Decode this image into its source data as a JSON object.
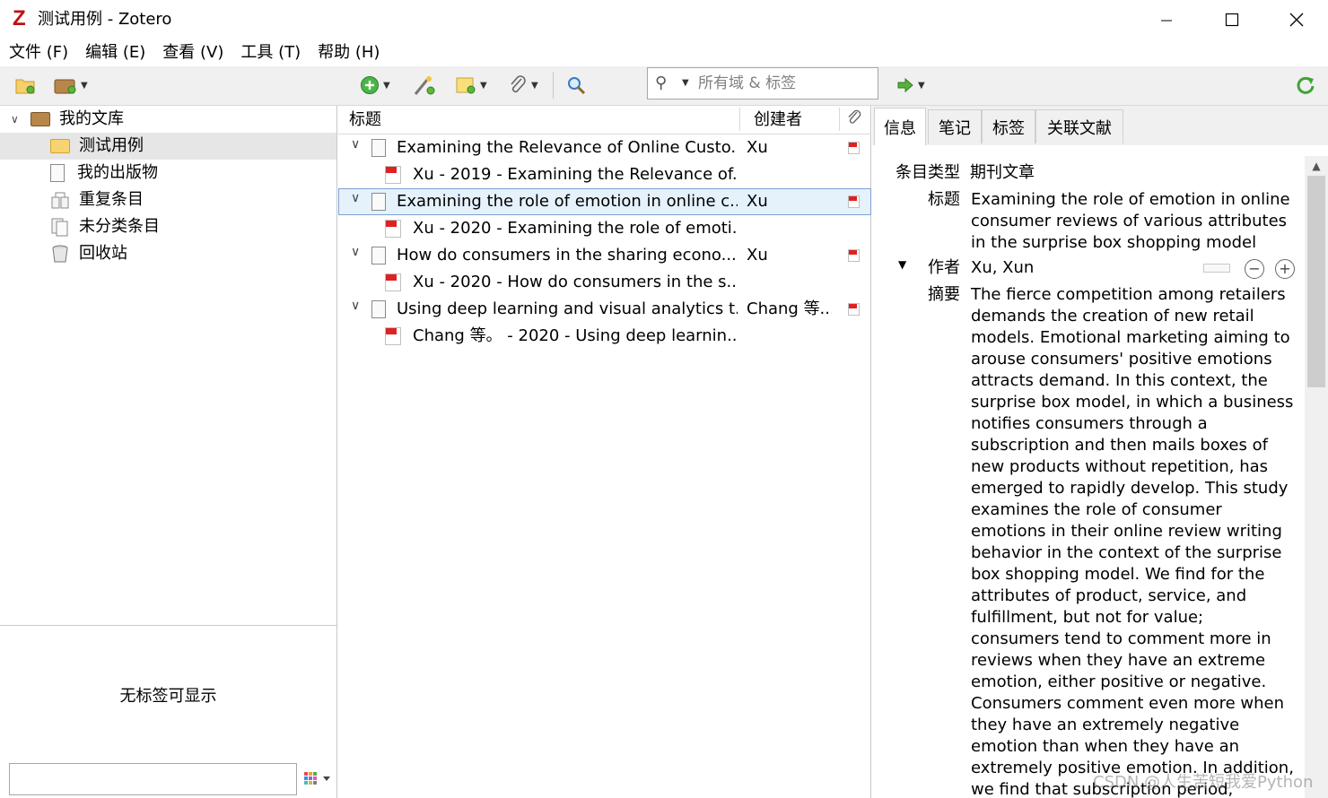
{
  "window": {
    "title": "测试用例 - Zotero",
    "logo_letter": "Z"
  },
  "menu": [
    "文件 (F)",
    "编辑 (E)",
    "查看 (V)",
    "工具 (T)",
    "帮助 (H)"
  ],
  "toolbar": {
    "search_placeholder": "所有域 & 标签",
    "icons": [
      "new-collection-icon",
      "new-library-icon",
      "new-item-icon",
      "add-by-identifier-icon",
      "new-note-icon",
      "attachment-icon",
      "advanced-search-icon",
      "sync-icon"
    ]
  },
  "collections": {
    "library": "我的文库",
    "items": [
      {
        "label": "测试用例",
        "icon": "folder-icon",
        "selected": true
      },
      {
        "label": "我的出版物",
        "icon": "publications-icon",
        "selected": false
      },
      {
        "label": "重复条目",
        "icon": "duplicates-icon",
        "selected": false
      },
      {
        "label": "未分类条目",
        "icon": "unfiled-icon",
        "selected": false
      },
      {
        "label": "回收站",
        "icon": "trash-icon",
        "selected": false
      }
    ]
  },
  "tags": {
    "empty_message": "无标签可显示",
    "filter_value": ""
  },
  "items_table": {
    "headers": {
      "title": "标题",
      "creator": "创建者"
    },
    "rows": [
      {
        "type": "parent",
        "title": "Examining the Relevance of Online Custo...",
        "creator": "Xu",
        "selected": false
      },
      {
        "type": "child",
        "title": "Xu - 2019 - Examining the Relevance of...",
        "creator": "",
        "selected": false
      },
      {
        "type": "parent",
        "title": "Examining the role of emotion in online c...",
        "creator": "Xu",
        "selected": true
      },
      {
        "type": "child",
        "title": "Xu - 2020 - Examining the role of emoti...",
        "creator": "",
        "selected": false
      },
      {
        "type": "parent",
        "title": "How do consumers in the sharing econo...",
        "creator": "Xu",
        "selected": false
      },
      {
        "type": "child",
        "title": "Xu - 2020 - How do consumers in the s...",
        "creator": "",
        "selected": false
      },
      {
        "type": "parent",
        "title": "Using deep learning and visual analytics t...",
        "creator": "Chang 等...",
        "selected": false
      },
      {
        "type": "child",
        "title": "Chang 等。 - 2020 - Using deep learnin...",
        "creator": "",
        "selected": false
      }
    ]
  },
  "detail": {
    "tabs": [
      "信息",
      "笔记",
      "标签",
      "关联文献"
    ],
    "active_tab": 0,
    "item_type_label": "条目类型",
    "item_type_value": "期刊文章",
    "title_label": "标题",
    "title_value": "Examining the role of emotion in online consumer reviews of various attributes in the surprise box shopping model",
    "author_label": "作者",
    "author_value": "Xu, Xun",
    "abstract_label": "摘要",
    "abstract_value": "The fierce competition among retailers demands the creation of new retail models. Emotional marketing aiming to arouse consumers' positive emotions attracts demand. In this context, the surprise box model, in which a business notifies consumers through a subscription and then mails boxes of new products without repetition, has emerged to rapidly develop. This study examines the role of consumer emotions in their online review writing behavior in the context of the surprise box shopping model. We find for the attributes of product, service, and fulfillment, but not for value; consumers tend to comment more in reviews when they have an extreme emotion, either positive or negative. Consumers comment even more when they have an extremely negative emotion than when they have an extremely positive emotion. In addition, we find that subscription period, experience, and consumers"
  },
  "watermark": "CSDN @人生苦短我爱Python"
}
